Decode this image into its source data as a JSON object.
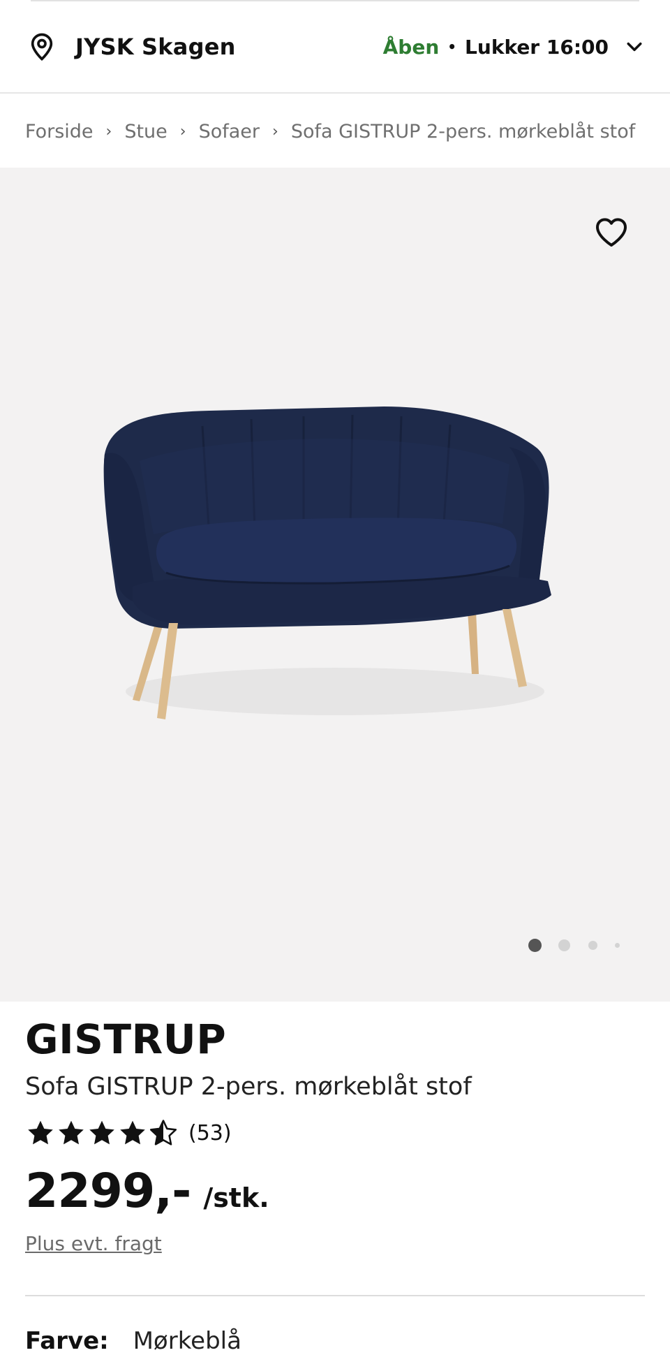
{
  "store": {
    "name": "JYSK Skagen",
    "status_open": "Åben",
    "status_separator": "•",
    "closing": "Lukker 16:00"
  },
  "breadcrumb": {
    "items": [
      "Forside",
      "Stue",
      "Sofaer",
      "Sofa GISTRUP 2-pers. mørkeblåt stof"
    ],
    "separator": "›"
  },
  "gallery": {
    "image_count": 4,
    "active_index": 0
  },
  "product": {
    "brand": "GISTRUP",
    "name": "Sofa GISTRUP 2-pers. mørkeblåt stof",
    "rating": 4.5,
    "rating_max": 5,
    "review_count": "(53)",
    "price": "2299,-",
    "price_unit": "/stk.",
    "shipping_note": "Plus evt. fragt",
    "color_label": "Farve:",
    "color_value": "Mørkeblå"
  },
  "colors": {
    "open_green": "#2e7d32",
    "sofa_blue": "#1e2a4a",
    "gallery_bg": "#f3f2f2",
    "leg_wood": "#d9b889"
  },
  "icons": [
    "location-pin-icon",
    "chevron-down-icon",
    "heart-icon",
    "star-icon",
    "half-star-icon"
  ]
}
